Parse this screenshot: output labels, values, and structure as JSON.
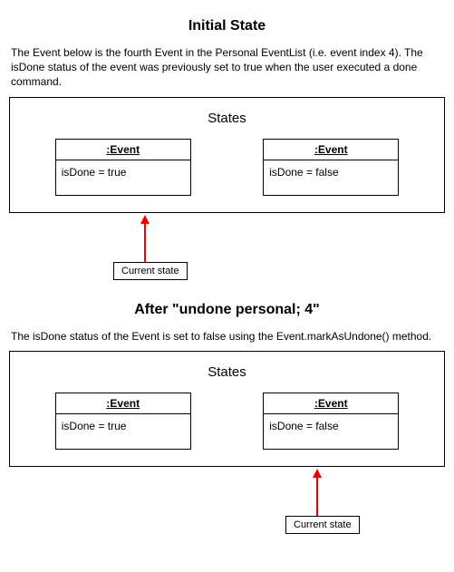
{
  "section1": {
    "title": "Initial State",
    "desc": "The Event below is the fourth Event in the Personal EventList (i.e. event index 4). The isDone status of the event was previously set to true when the user executed a done command.",
    "states_label": "States",
    "event_left": {
      "header": ":Event",
      "body": "isDone = true"
    },
    "event_right": {
      "header": ":Event",
      "body": "isDone = false"
    },
    "current_state": "Current state"
  },
  "section2": {
    "title": "After \"undone personal; 4\"",
    "desc": "The isDone status of the Event is set to false using the Event.markAsUndone() method.",
    "states_label": "States",
    "event_left": {
      "header": ":Event",
      "body": "isDone = true"
    },
    "event_right": {
      "header": ":Event",
      "body": "isDone = false"
    },
    "current_state": "Current state"
  }
}
